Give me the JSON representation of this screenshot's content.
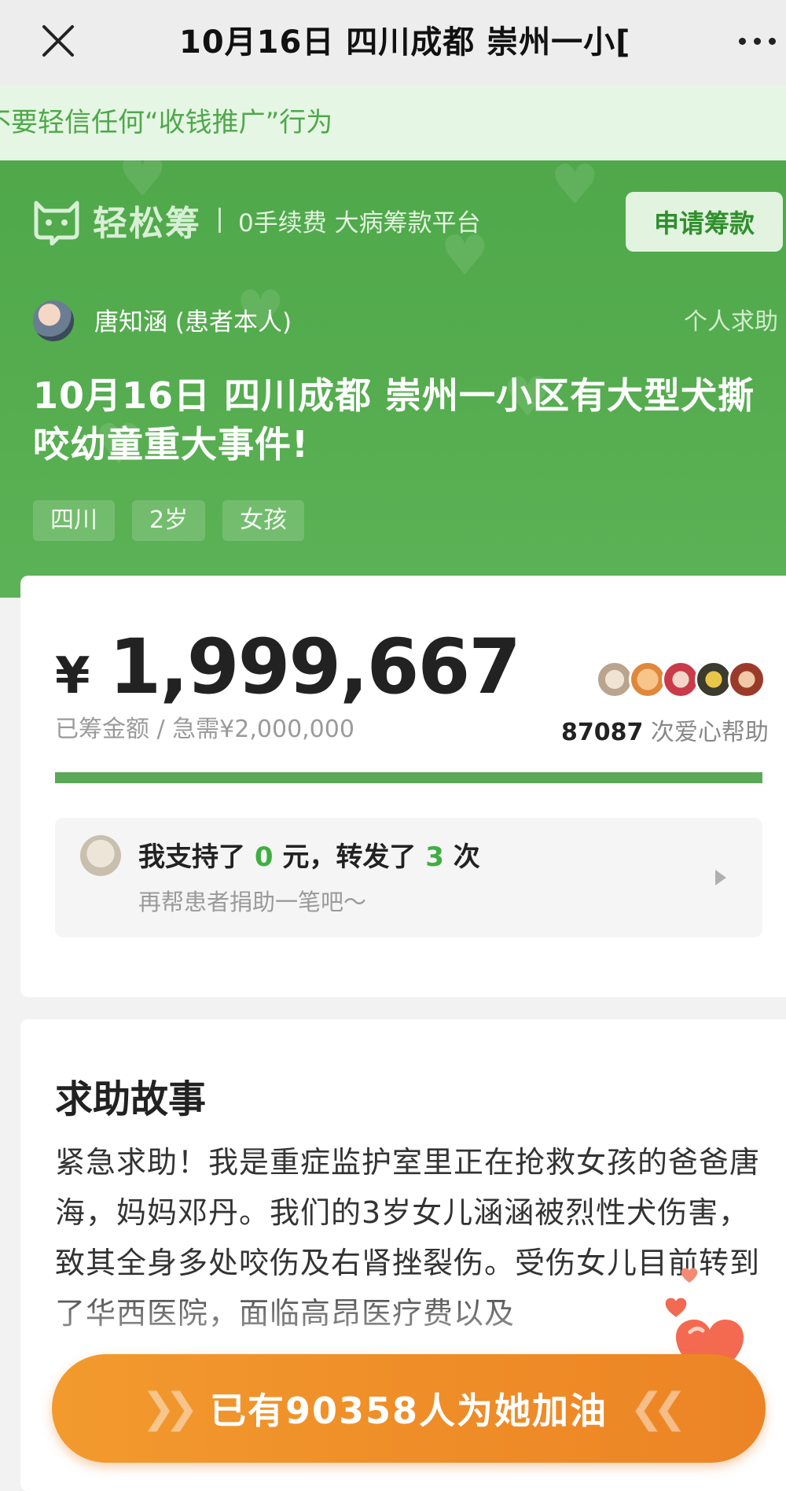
{
  "navbar": {
    "title": "10月16日 四川成都 崇州一小[",
    "close_icon": "close-icon",
    "more_icon": "more-dots-icon"
  },
  "warning": {
    "text": "不要轻信任何“收钱推广”行为"
  },
  "header": {
    "logo_name": "轻松筹",
    "slogan": "0手续费 大病筹款平台",
    "apply_button": "申请筹款",
    "user_name": "唐知涵 (患者本人)",
    "help_type": "个人求助",
    "title": "10月16日 四川成都 崇州一小区有大型犬撕咬幼童重大事件!",
    "tags": [
      "四川",
      "2岁",
      "女孩"
    ]
  },
  "fundraising": {
    "currency_symbol": "¥",
    "raised_amount": "1,999,667",
    "raised_label": "已筹金额 / 急需¥2,000,000",
    "help_count": "87087",
    "help_count_suffix": " 次爱心帮助",
    "progress_fraction": 0.9998,
    "support": {
      "prefix": "我支持了 ",
      "donated": "0",
      "middle": " 元，转发了 ",
      "shares": "3",
      "suffix": " 次",
      "subtext": "再帮患者捐助一笔吧～"
    }
  },
  "story": {
    "title": "求助故事",
    "text": "紧急求助！我是重症监护室里正在抢救女孩的爸爸唐海，妈妈邓丹。我们的3岁女儿涵涵被烈性犬伤害，致其全身多处咬伤及右肾挫裂伤。受伤女儿目前转到了华西医院，面临高昂医疗费以及"
  },
  "cheer_button": {
    "label": "已有90358人为她加油"
  },
  "colors": {
    "brand_green": "#55ad4f",
    "accent_green": "#3fae42",
    "cheer_orange": "#ef8e28",
    "progress": "#5aa858"
  }
}
